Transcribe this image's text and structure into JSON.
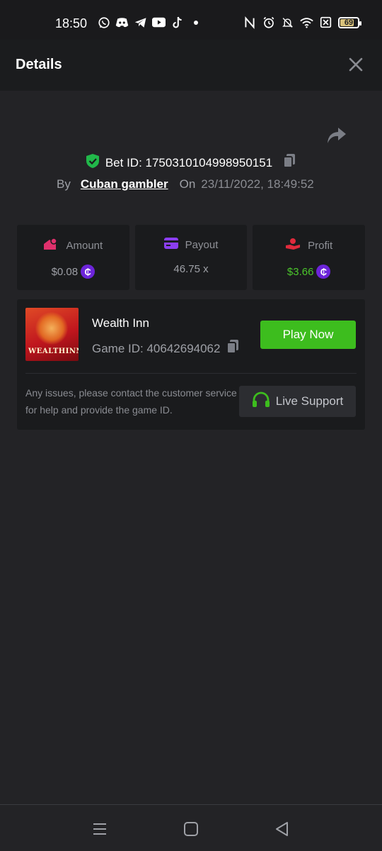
{
  "status_bar": {
    "time": "18:50",
    "battery": "69"
  },
  "header": {
    "title": "Details"
  },
  "bet": {
    "id_label": "Bet ID: 1750310104998950151",
    "by_label": "By",
    "user": "Cuban gambler",
    "on_label": "On",
    "date": "23/11/2022, 18:49:52"
  },
  "stats": {
    "amount_label": "Amount",
    "amount_value": "$0.08",
    "payout_label": "Payout",
    "payout_value": "46.75 x",
    "profit_label": "Profit",
    "profit_value": "$3.66",
    "coin_symbol": "₵"
  },
  "game": {
    "thumb_text": "WEALTHINN",
    "name": "Wealth Inn",
    "id_label": "Game ID: 40642694062",
    "play_label": "Play Now",
    "help_text": "Any issues, please contact the customer service for help and provide the game ID.",
    "support_label": "Live Support"
  },
  "colors": {
    "accent_green": "#3dbd1e",
    "profit_green": "#4bc62b",
    "coin_purple": "#6c24d9",
    "shield_green": "#21b84a"
  }
}
